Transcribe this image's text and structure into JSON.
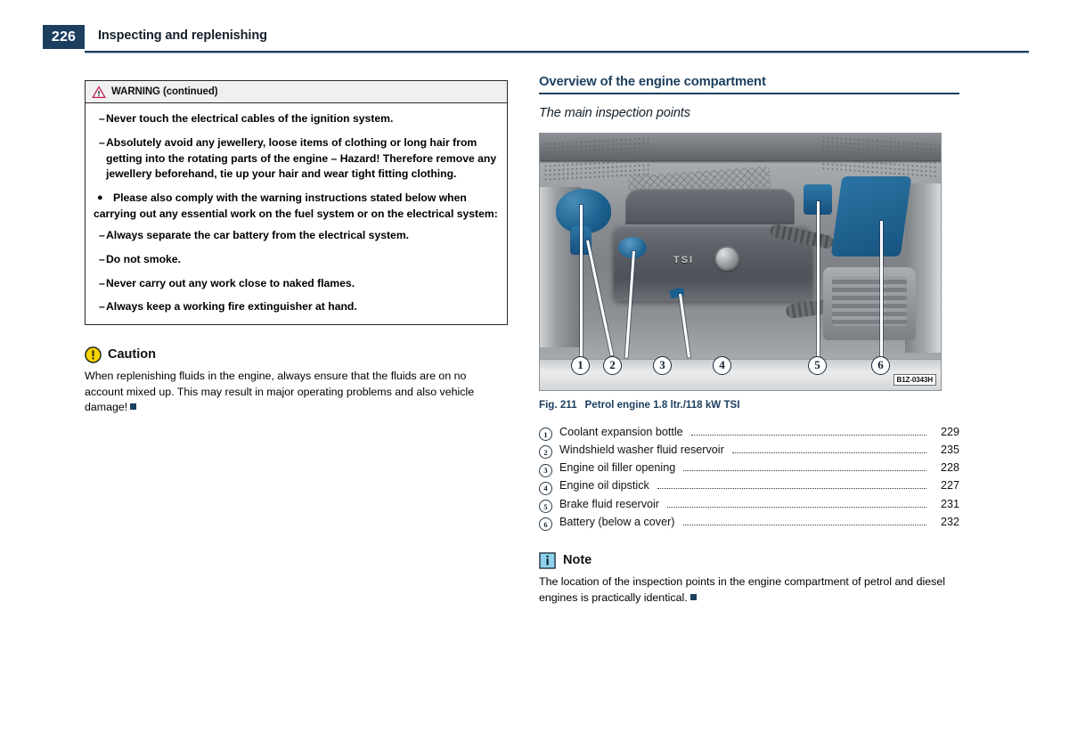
{
  "header": {
    "page_number": "226",
    "title": "Inspecting and replenishing",
    "accent_color": "#1c3f5f"
  },
  "left_column": {
    "warning_box": {
      "icon": "warning-triangle-icon",
      "title": "WARNING (continued)",
      "items": [
        {
          "marker": "dash",
          "text": "Never touch the electrical cables of the ignition system."
        },
        {
          "marker": "dash",
          "text": "Absolutely avoid any jewellery, loose items of clothing or long hair from getting into the rotating parts of the engine – Hazard! Therefore remove any jewellery beforehand, tie up your hair and wear tight fitting clothing."
        },
        {
          "marker": "bullet",
          "text": "Please also comply with the warning instructions stated below when carrying out any essential work on the fuel system or on the electrical system:"
        },
        {
          "marker": "dash",
          "text": "Always separate the car battery from the electrical system."
        },
        {
          "marker": "dash",
          "text": "Do not smoke."
        },
        {
          "marker": "dash",
          "text": "Never carry out any work close to naked flames."
        },
        {
          "marker": "dash",
          "text": "Always keep a working fire extinguisher at hand."
        }
      ]
    },
    "caution": {
      "icon": "caution-circle-icon",
      "title": "Caution",
      "text": "When replenishing fluids in the engine, always ensure that the fluids are on no account mixed up. This may result in major operating problems and also vehicle damage!"
    }
  },
  "right_column": {
    "section_title": "Overview of the engine compartment",
    "subsection_title": "The main inspection points",
    "figure": {
      "image_code": "B1Z-0343H",
      "caption_number": "Fig. 211",
      "caption_text": "Petrol engine 1.8 ltr./118 kW TSI",
      "alt": "Engine compartment photo with six numbered callouts",
      "highlight_color": "#1b5f8e",
      "callouts": [
        "1",
        "2",
        "3",
        "4",
        "5",
        "6"
      ]
    },
    "legend": {
      "rows": [
        {
          "num": "1",
          "label": "Coolant expansion bottle",
          "page": "229"
        },
        {
          "num": "2",
          "label": "Windshield washer fluid reservoir",
          "page": "235"
        },
        {
          "num": "3",
          "label": "Engine oil filler opening",
          "page": "228"
        },
        {
          "num": "4",
          "label": "Engine oil dipstick",
          "page": "227"
        },
        {
          "num": "5",
          "label": "Brake fluid reservoir",
          "page": "231"
        },
        {
          "num": "6",
          "label": "Battery (below a cover)",
          "page": "232"
        }
      ]
    },
    "note": {
      "icon": "info-note-icon",
      "title": "Note",
      "text": "The location of the inspection points in the engine compartment of petrol and diesel engines is practically identical."
    }
  }
}
